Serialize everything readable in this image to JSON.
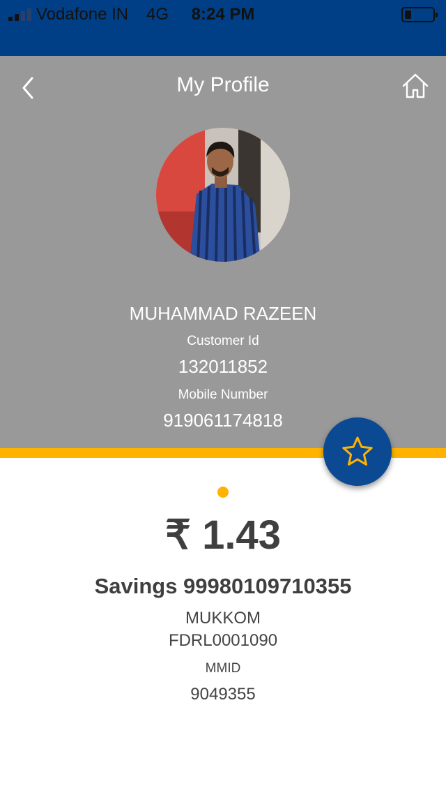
{
  "status_bar": {
    "carrier": "Vodafone IN",
    "network": "4G",
    "time": "8:24 PM",
    "signal_bars_filled": 2,
    "signal_bars_total": 4,
    "battery_level": 0.2
  },
  "header": {
    "title": "My Profile",
    "back_icon": "chevron-left-icon",
    "home_icon": "home-icon"
  },
  "profile": {
    "name": "MUHAMMAD RAZEEN",
    "customer_id_label": "Customer Id",
    "customer_id": "132011852",
    "mobile_label": "Mobile Number",
    "mobile_number": "919061174818"
  },
  "favorite_icon": "star-icon",
  "account": {
    "balance": "₹ 1.43",
    "title": "Savings 99980109710355",
    "branch": "MUKKOM",
    "ifsc": "FDRL0001090",
    "mmid_label": "MMID",
    "mmid": "9049355"
  },
  "colors": {
    "status_bar": "#003f85",
    "header_background": "#999999",
    "accent": "#ffb300",
    "favorite_button": "#0b4a93",
    "text_dark": "#3f3f3f"
  }
}
